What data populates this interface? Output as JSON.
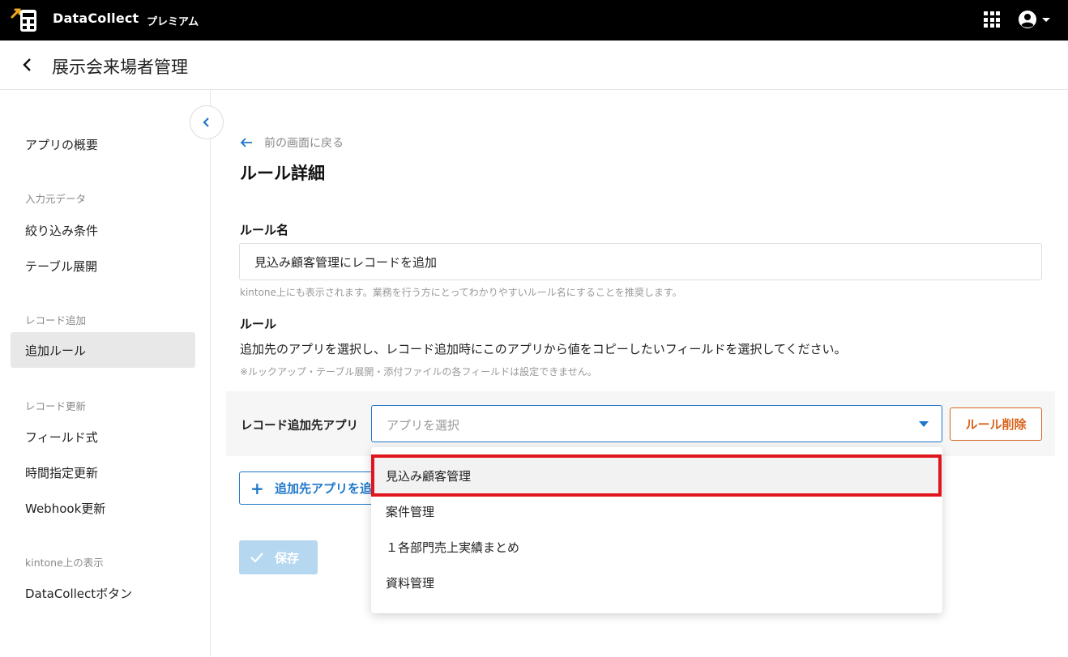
{
  "topbar": {
    "brand": "DataCollect",
    "plan": "プレミアム"
  },
  "header": {
    "title": "展示会来場者管理"
  },
  "sidebar": {
    "overview": "アプリの概要",
    "group_input": "入力元データ",
    "filter": "絞り込み条件",
    "table_expand": "テーブル展開",
    "group_add": "レコード追加",
    "add_rule": "追加ルール",
    "group_update": "レコード更新",
    "field_formula": "フィールド式",
    "scheduled_update": "時間指定更新",
    "webhook_update": "Webhook更新",
    "group_kintone": "kintone上の表示",
    "dc_button": "DataCollectボタン"
  },
  "main": {
    "back_link": "前の画面に戻る",
    "heading": "ルール詳細",
    "rule_name_label": "ルール名",
    "rule_name_value": "見込み顧客管理にレコードを追加",
    "rule_name_hint": "kintone上にも表示されます。業務を行う方にとってわかりやすいルール名にすることを推奨します。",
    "rule_label": "ルール",
    "rule_desc": "追加先のアプリを選択し、レコード追加時にこのアプリから値をコピーしたいフィールドを選択してください。",
    "rule_note": "※ルックアップ・テーブル展開・添付ファイルの各フィールドは設定できません。",
    "target_app_label": "レコード追加先アプリ",
    "select_placeholder": "アプリを選択",
    "delete_button": "ルール削除",
    "add_target_button": "追加先アプリを追加",
    "save_button": "保存"
  },
  "dropdown": {
    "options": [
      "見込み顧客管理",
      "案件管理",
      "１各部門売上実績まとめ",
      "資料管理"
    ]
  },
  "colors": {
    "accent": "#1f77c9",
    "danger": "#d9631c",
    "highlight_box": "#e0151d"
  }
}
